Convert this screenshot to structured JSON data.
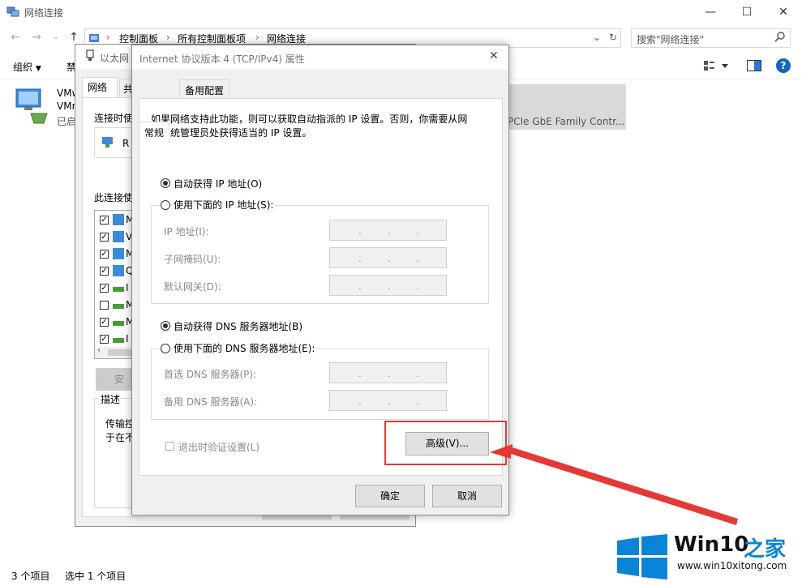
{
  "window": {
    "title": "网络连接",
    "minimize": "—",
    "maximize": "☐",
    "close": "✕"
  },
  "address": {
    "crumbs": [
      "控制面板",
      "所有控制面板项",
      "网络连接"
    ],
    "search_placeholder": "搜索\"网络连接\""
  },
  "toolbar": {
    "organize": "组织",
    "disable": "禁"
  },
  "adapters": [
    {
      "line1": "VMw",
      "line2": "VMn",
      "line3": "已启"
    },
    {
      "line1": "PCIe GbE Family Contr..."
    }
  ],
  "status": {
    "count": "3 个项目",
    "selected": "选中 1 个项目"
  },
  "ethernet_dialog": {
    "title": "以太网",
    "tab_network": "网络",
    "tab_share": "共",
    "connect_using": "连接时使",
    "adapter_initial": "R",
    "items_label": "此连接使",
    "items": [
      {
        "checked": true,
        "text": "M"
      },
      {
        "checked": true,
        "text": "V"
      },
      {
        "checked": true,
        "text": "M"
      },
      {
        "checked": true,
        "text": "Q"
      },
      {
        "checked": true,
        "text": "I"
      },
      {
        "checked": false,
        "text": "M"
      },
      {
        "checked": true,
        "text": "M"
      },
      {
        "checked": true,
        "text": "I"
      }
    ],
    "install_button": "安",
    "description_label": "描述",
    "description_line1": "传输控",
    "description_line2": "于在不"
  },
  "ipv4_dialog": {
    "title": "Internet 协议版本 4 (TCP/IPv4) 属性",
    "tab_general": "常规",
    "tab_alternate": "备用配置",
    "intro_line1": "如果网络支持此功能，则可以获取自动指派的 IP 设置。否则，你需要从网",
    "intro_line2": "络系统管理员处获得适当的 IP 设置。",
    "auto_ip": "自动获得 IP 地址(O)",
    "manual_ip": "使用下面的 IP 地址(S):",
    "ip_address": "IP 地址(I):",
    "subnet_mask": "子网掩码(U):",
    "default_gateway": "默认网关(D):",
    "auto_dns": "自动获得 DNS 服务器地址(B)",
    "manual_dns": "使用下面的 DNS 服务器地址(E):",
    "preferred_dns": "首选 DNS 服务器(P):",
    "alternate_dns": "备用 DNS 服务器(A):",
    "validate_on_exit": "退出时验证设置(L)",
    "advanced_button": "高级(V)...",
    "ok_button": "确定",
    "cancel_button": "取消",
    "ip_dot": "."
  },
  "watermark": {
    "brand": "Win10",
    "brand_suffix": "之家",
    "url": "www.win10xitong.com"
  },
  "colors": {
    "highlight_red": "#e53935",
    "help_blue": "#1565c0",
    "logo_blue": "#0a84d6"
  }
}
